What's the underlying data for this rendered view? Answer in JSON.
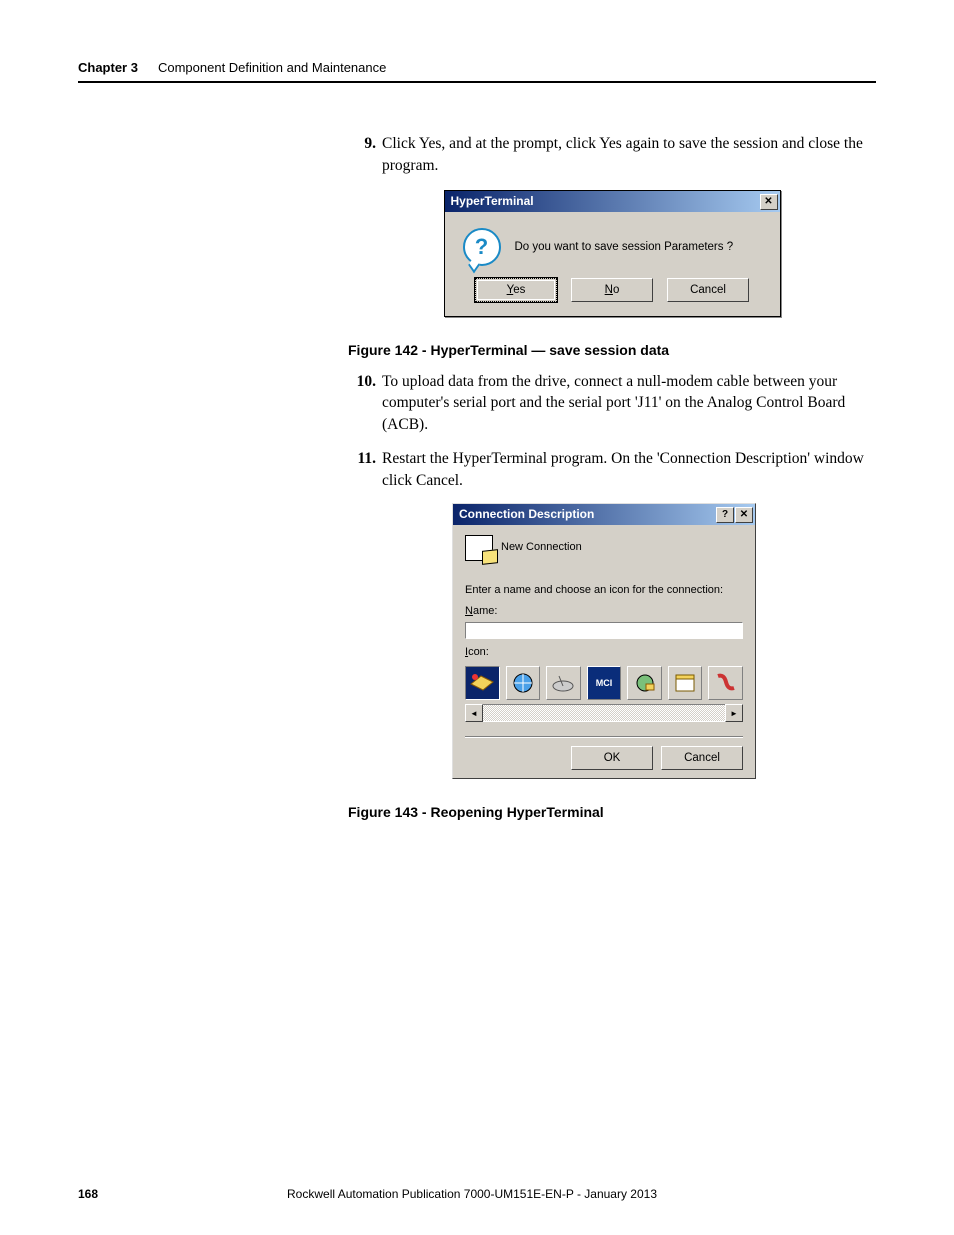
{
  "header": {
    "chapter": "Chapter 3",
    "title": "Component Definition and Maintenance"
  },
  "steps": {
    "s9_num": "9.",
    "s9": "Click Yes, and at the prompt, click Yes again to save the session and close the program.",
    "s10_num": "10.",
    "s10": "To upload data from the drive, connect a null-modem cable between your computer's serial port and the serial port 'J11' on the Analog Control Board (ACB).",
    "s11_num": "11.",
    "s11": "Restart the HyperTerminal program. On the 'Connection Description' window click Cancel."
  },
  "fig142": "Figure 142 - HyperTerminal — save session data",
  "fig143": "Figure 143 - Reopening HyperTerminal",
  "dialog1": {
    "title": "HyperTerminal",
    "message": "Do you want to save session Parameters ?",
    "yes_u": "Y",
    "yes_r": "es",
    "no_u": "N",
    "no_r": "o",
    "cancel": "Cancel"
  },
  "dialog2": {
    "title": "Connection Description",
    "newconn": "New Connection",
    "prompt": "Enter a name and choose an icon for the connection:",
    "name_u": "N",
    "name_r": "ame:",
    "icon_u": "I",
    "icon_r": "con:",
    "icons": [
      "",
      "",
      "",
      "MCI",
      "",
      "",
      ""
    ],
    "ok": "OK",
    "cancel": "Cancel"
  },
  "footer": {
    "page": "168",
    "pub": "Rockwell Automation Publication 7000-UM151E-EN-P - January 2013"
  }
}
